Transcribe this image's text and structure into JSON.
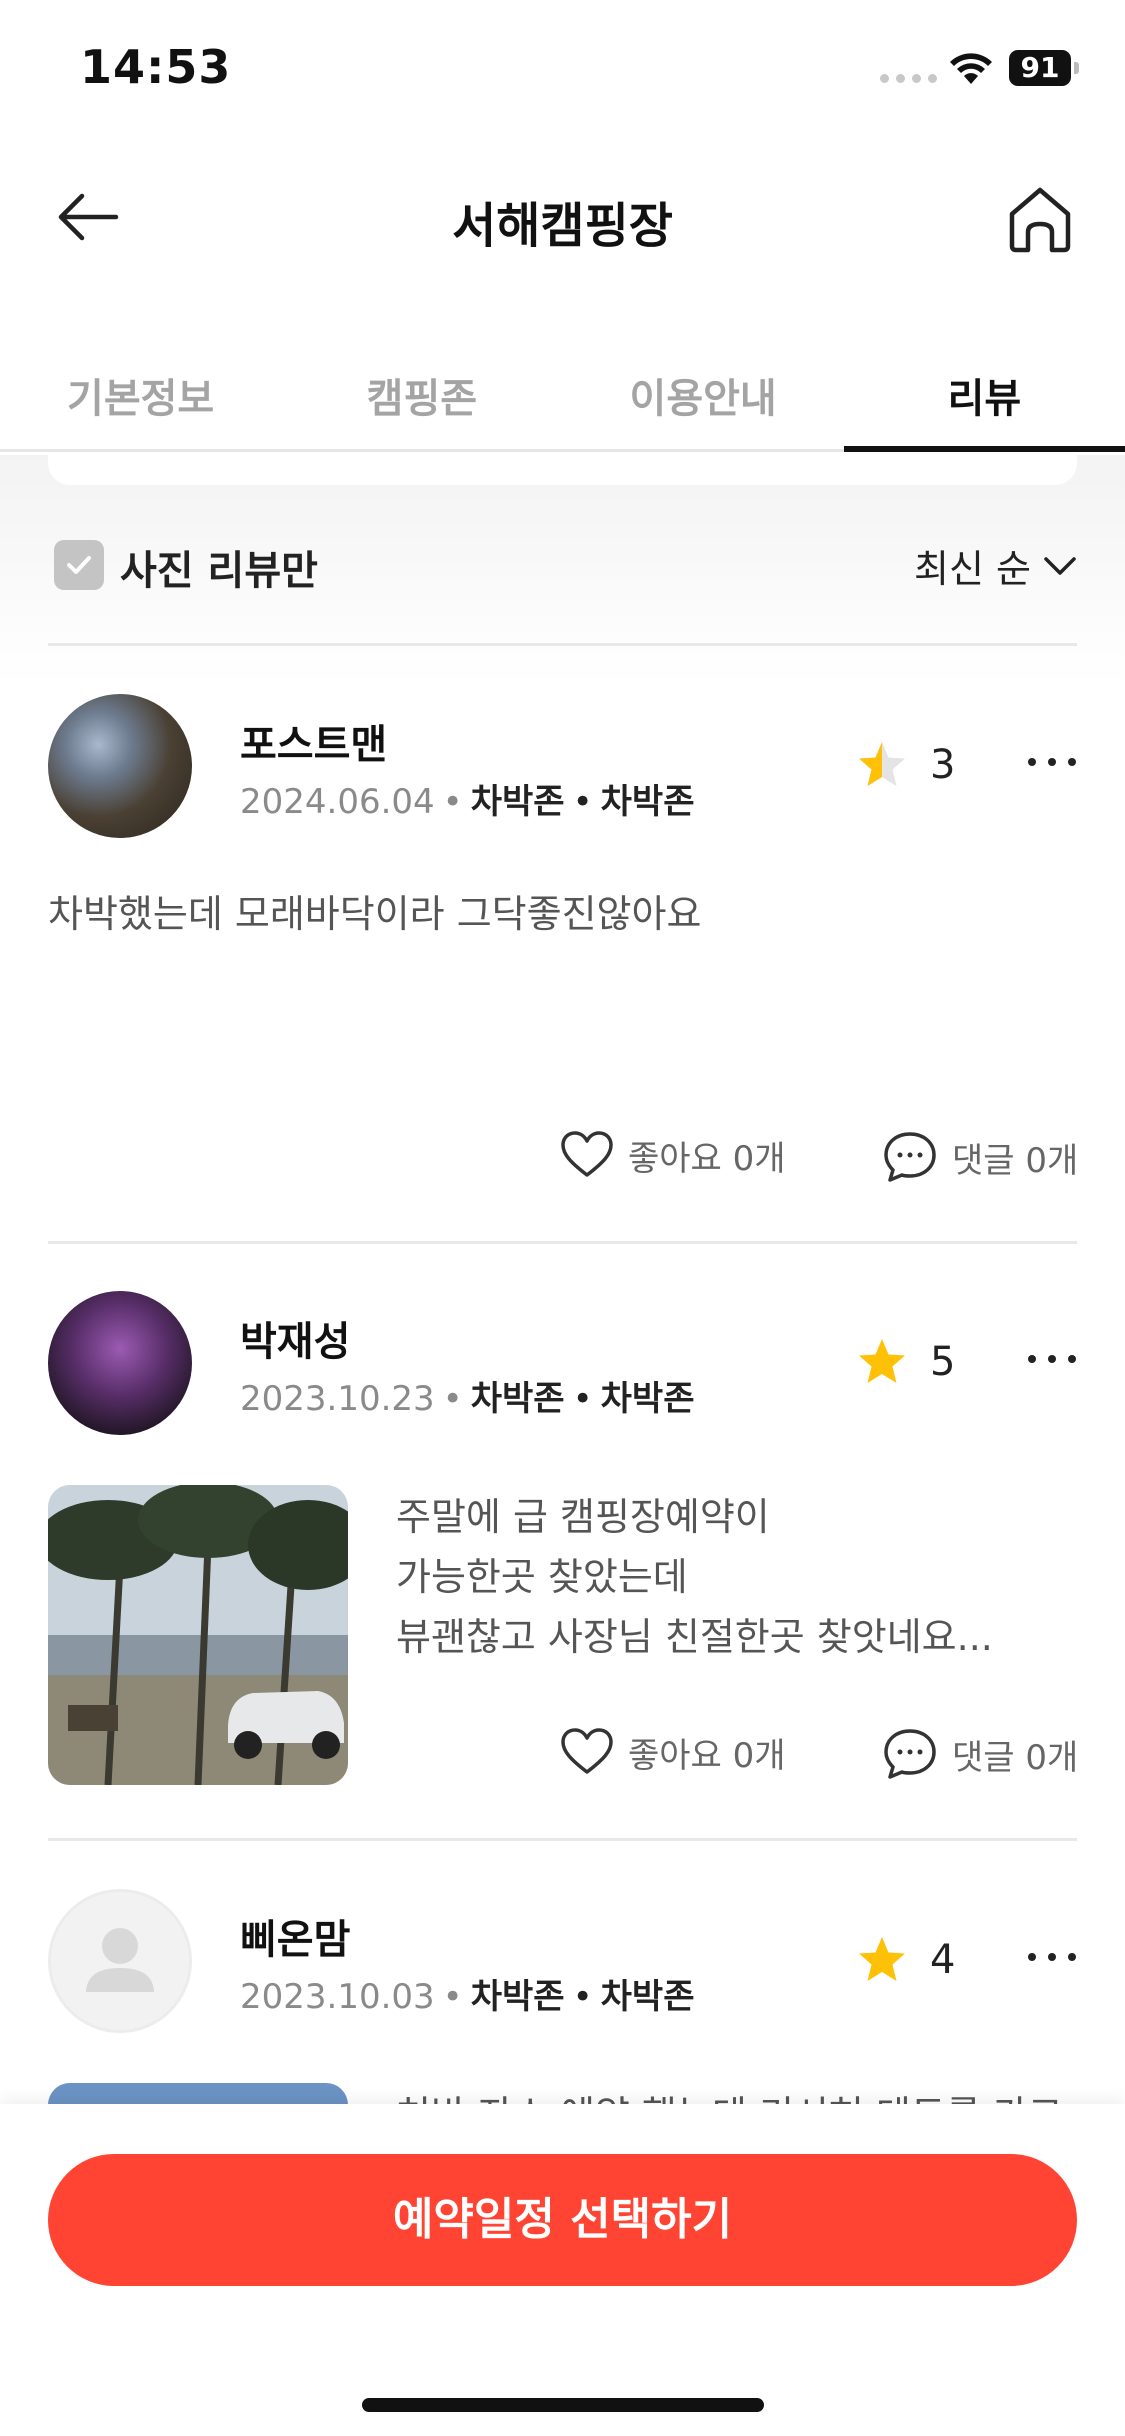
{
  "status": {
    "time": "14:53",
    "battery": "91"
  },
  "header": {
    "title": "서해캠핑장"
  },
  "tabs": [
    "기본정보",
    "캠핑존",
    "이용안내",
    "리뷰"
  ],
  "filter": {
    "label": "사진 리뷰만",
    "sort": "최신 순"
  },
  "reviews": [
    {
      "name": "포스트맨",
      "date": "2024.06.04",
      "zone1": "차박존",
      "zone2": "차박존",
      "rating": "3",
      "text": "차박했는데 모래바닥이라 그닥좋진않아요",
      "likes": "좋아요 0개",
      "comments": "댓글 0개"
    },
    {
      "name": "박재성",
      "date": "2023.10.23",
      "zone1": "차박존",
      "zone2": "차박존",
      "rating": "5",
      "text_lines": [
        "주말에 급 캠핑장예약이",
        "가능한곳 찾았는데",
        "뷰괜찮고 사장님 친절한곳 찾앗네요..."
      ],
      "likes": "좋아요 0개",
      "comments": "댓글 0개"
    },
    {
      "name": "삐온맘",
      "date": "2023.10.03",
      "zone1": "차박존",
      "zone2": "차박존",
      "rating": "4",
      "text": "처박 자소 예약 했는데 기시혀 데도를 가고"
    }
  ],
  "cta": {
    "label": "예약일정 선택하기"
  },
  "colors": {
    "accent": "#ff4433",
    "star": "#ffc107"
  }
}
